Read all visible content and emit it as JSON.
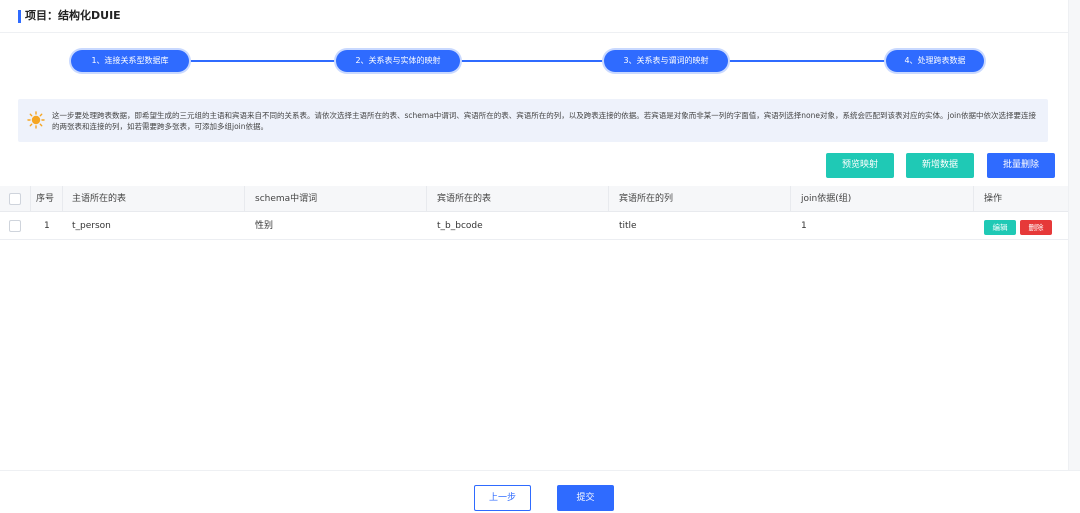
{
  "header": {
    "title": "项目：结构化DUIE"
  },
  "steps": [
    {
      "label": "1、连接关系型数据库"
    },
    {
      "label": "2、关系表与实体的映射"
    },
    {
      "label": "3、关系表与谓词的映射"
    },
    {
      "label": "4、处理跨表数据"
    }
  ],
  "notice": {
    "icon": "sun-tip-icon",
    "text": "这一步要处理跨表数据，即希望生成的三元组的主语和宾语来自不同的关系表。请依次选择主语所在的表、schema中谓词、宾语所在的表、宾语所在的列，以及跨表连接的依据。若宾语是对象而非某一列的字面值，宾语列选择none对象，系统会匹配到该表对应的实体。join依据中依次选择要连接的两张表和连接的列，如若需要跨多张表，可添加多组join依据。"
  },
  "actions": {
    "preview": "预览映射",
    "add": "新增数据",
    "batch_delete": "批量删除"
  },
  "table": {
    "headers": {
      "index": "序号",
      "subject_table": "主语所在的表",
      "predicate": "schema中谓词",
      "object_table": "宾语所在的表",
      "object_column": "宾语所在的列",
      "join": "join依据(组)",
      "ops": "操作"
    },
    "rows": [
      {
        "index": "1",
        "subject_table": "t_person",
        "predicate": "性别",
        "object_table": "t_b_bcode",
        "object_column": "title",
        "join": "1",
        "edit": "编辑",
        "delete": "删除"
      }
    ]
  },
  "footer": {
    "prev": "上一步",
    "submit": "提交"
  },
  "colors": {
    "primary": "#2f6bff",
    "teal": "#1fc9b5",
    "danger": "#e63939",
    "notice_bg": "#eef2fb"
  }
}
